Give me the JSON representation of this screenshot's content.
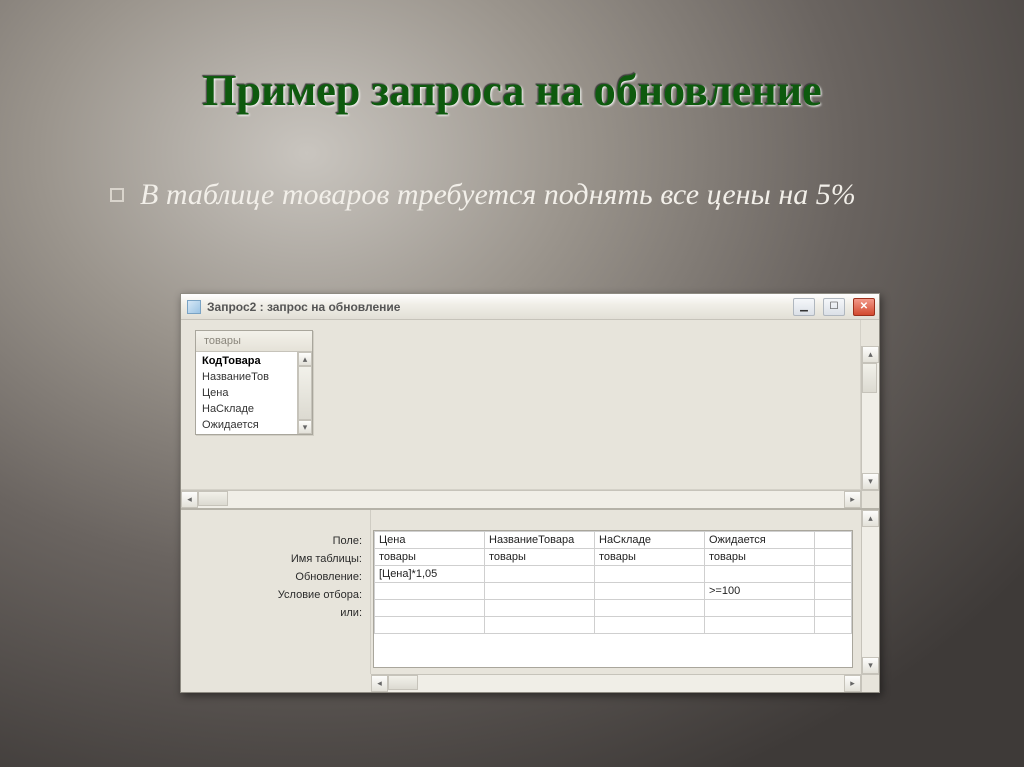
{
  "slide": {
    "title": "Пример запроса на обновление",
    "bullet": "В таблице товаров требуется поднять все цены на 5%"
  },
  "window": {
    "title": "Запрос2 : запрос на обновление"
  },
  "fieldlist": {
    "title": "товары",
    "items": [
      "КодТовара",
      "НазваниеТов",
      "Цена",
      "НаСкладе",
      "Ожидается"
    ]
  },
  "grid": {
    "labels": {
      "field": "Поле:",
      "table": "Имя таблицы:",
      "update": "Обновление:",
      "criteria": "Условие отбора:",
      "or": "или:"
    },
    "cols": [
      {
        "field": "Цена",
        "table": "товары",
        "update": "[Цена]*1,05",
        "criteria": "",
        "or": ""
      },
      {
        "field": "НазваниеТовара",
        "table": "товары",
        "update": "",
        "criteria": "",
        "or": ""
      },
      {
        "field": "НаСкладе",
        "table": "товары",
        "update": "",
        "criteria": "",
        "or": ""
      },
      {
        "field": "Ожидается",
        "table": "товары",
        "update": "",
        "criteria": ">=100",
        "or": ""
      }
    ]
  }
}
